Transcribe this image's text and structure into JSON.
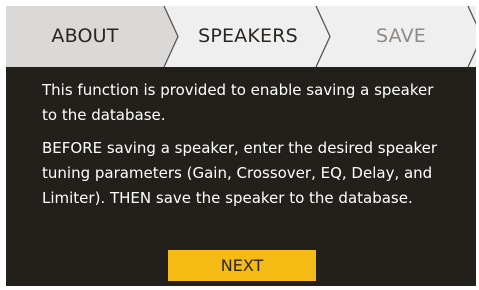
{
  "tabs": {
    "about": "ABOUT",
    "speakers": "SPEAKERS",
    "save": "SAVE"
  },
  "body": {
    "paragraph_1": "This function is provided to enable saving a speaker to the database.",
    "paragraph_2": "BEFORE saving a speaker, enter the desired speaker tuning parameters (Gain, Crossover, EQ, Delay, and Limiter). THEN save the speaker to the database."
  },
  "actions": {
    "next_label": "NEXT"
  },
  "colors": {
    "panel_background": "#231f1b",
    "active_tab": "#dad9d7",
    "inactive_tab": "#efefef",
    "disabled_tab_text": "#8e8a86",
    "accent_button": "#f6ba14"
  }
}
